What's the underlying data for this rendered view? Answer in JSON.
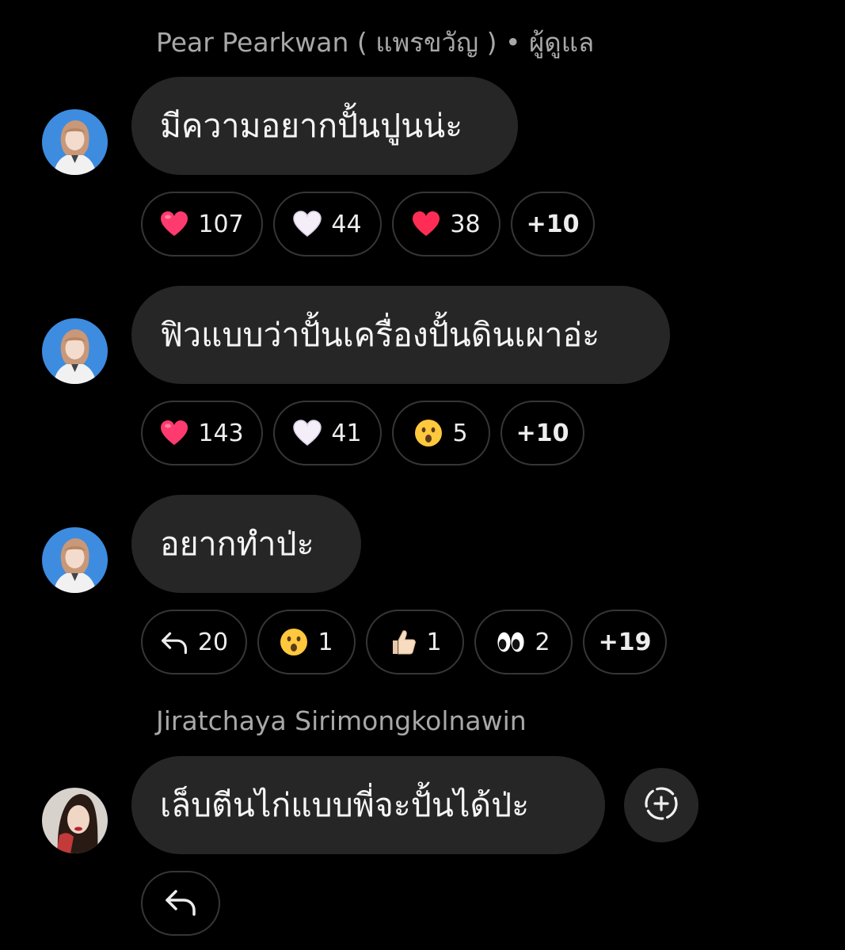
{
  "thread": {
    "sender_1": "Pear Pearkwan ( แพรขวัญ ) • ผู้ดูแล",
    "sender_2": "Jiratchaya Sirimongkolnawin",
    "messages": [
      {
        "text": "มีความอยากปั้นปูนน่ะ",
        "reactions": [
          {
            "icon": "pink-heart-icon",
            "count": "107"
          },
          {
            "icon": "white-heart-icon",
            "count": "44"
          },
          {
            "icon": "red-heart-icon",
            "count": "38"
          }
        ],
        "more": "+10"
      },
      {
        "text": "ฟิวแบบว่าปั้นเครื่องปั้นดินเผาอ่ะ",
        "reactions": [
          {
            "icon": "pink-heart-icon",
            "count": "143"
          },
          {
            "icon": "white-heart-icon",
            "count": "41"
          },
          {
            "icon": "surprised-face-icon",
            "count": "5"
          }
        ],
        "more": "+10"
      },
      {
        "text": "อยากทำป่ะ",
        "reactions": [
          {
            "icon": "reply-arrow-icon",
            "count": "20"
          },
          {
            "icon": "surprised-face-icon",
            "count": "1"
          },
          {
            "icon": "thumbs-up-icon",
            "count": "1"
          },
          {
            "icon": "eyes-icon",
            "count": "2"
          }
        ],
        "more": "+19"
      },
      {
        "text": "เล็บตีนไก่แบบพี่จะปั้นได้ป่ะ"
      }
    ]
  },
  "colors": {
    "background": "#000000",
    "bubble": "#262626",
    "pill_border": "#363636",
    "sender_text": "#a8a8a8",
    "pink_heart": "#ff3a6e",
    "red_heart": "#ff2d55"
  }
}
